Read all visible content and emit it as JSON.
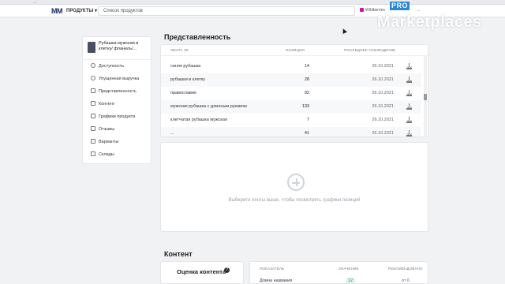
{
  "browser": {
    "url": "..."
  },
  "header": {
    "logo": "MM",
    "products_label": "ПРОДУКТЫ",
    "search_placeholder": "Список продуктов",
    "wb_label": "Wildberries",
    "user_label": "...",
    "watermark_pro": "PRO",
    "watermark_text": "Marketplaces"
  },
  "sidebar": {
    "product_name": "Рубашка мужская в клетку/ фланель/...",
    "items": [
      {
        "label": "Доступность",
        "icon": "clock-icon"
      },
      {
        "label": "Упущенная выручка",
        "icon": "chart-icon"
      },
      {
        "label": "Представленность",
        "icon": "bars-icon"
      },
      {
        "label": "Контент",
        "icon": "image-icon"
      },
      {
        "label": "Графики продукта",
        "icon": "graph-icon"
      },
      {
        "label": "Отзывы",
        "icon": "comment-icon"
      },
      {
        "label": "Варианты",
        "icon": "grid-icon"
      },
      {
        "label": "Склады",
        "icon": "truck-icon"
      }
    ]
  },
  "presence": {
    "title": "Представленность",
    "columns": {
      "keyword": "ЛЕНТА 35",
      "position": "ПОЗИЦИЯ",
      "last_seen": "ПОСЛЕДНЕЕ НАБЛЮДЕНИЕ"
    },
    "rows": [
      {
        "keyword": "синяя рубашка",
        "position": "14",
        "date": "26.10.2021"
      },
      {
        "keyword": "рубашки в клетку",
        "position": "28",
        "date": "26.10.2021"
      },
      {
        "keyword": "православие",
        "position": "92",
        "date": "26.10.2021"
      },
      {
        "keyword": "мужская рубашка с длинным рукавом",
        "position": "133",
        "date": "26.10.2021"
      },
      {
        "keyword": "клетчатая рубашка мужская",
        "position": "7",
        "date": "26.10.2021"
      },
      {
        "keyword": "...",
        "position": "41",
        "date": "26.10.2021"
      }
    ],
    "empty_hint": "Выберите ленты выше, чтобы посмотреть графики позиций"
  },
  "content": {
    "title": "Контент",
    "score_title": "Оценка контента",
    "columns": {
      "indicator": "ПОКАЗАТЕЛЬ",
      "value": "ЗНАЧЕНИЕ",
      "recommended": "РЕКОМЕНДОВАНО"
    },
    "rows": [
      {
        "indicator": "Длина названия",
        "value": "12",
        "recommended": "от 6"
      }
    ]
  }
}
